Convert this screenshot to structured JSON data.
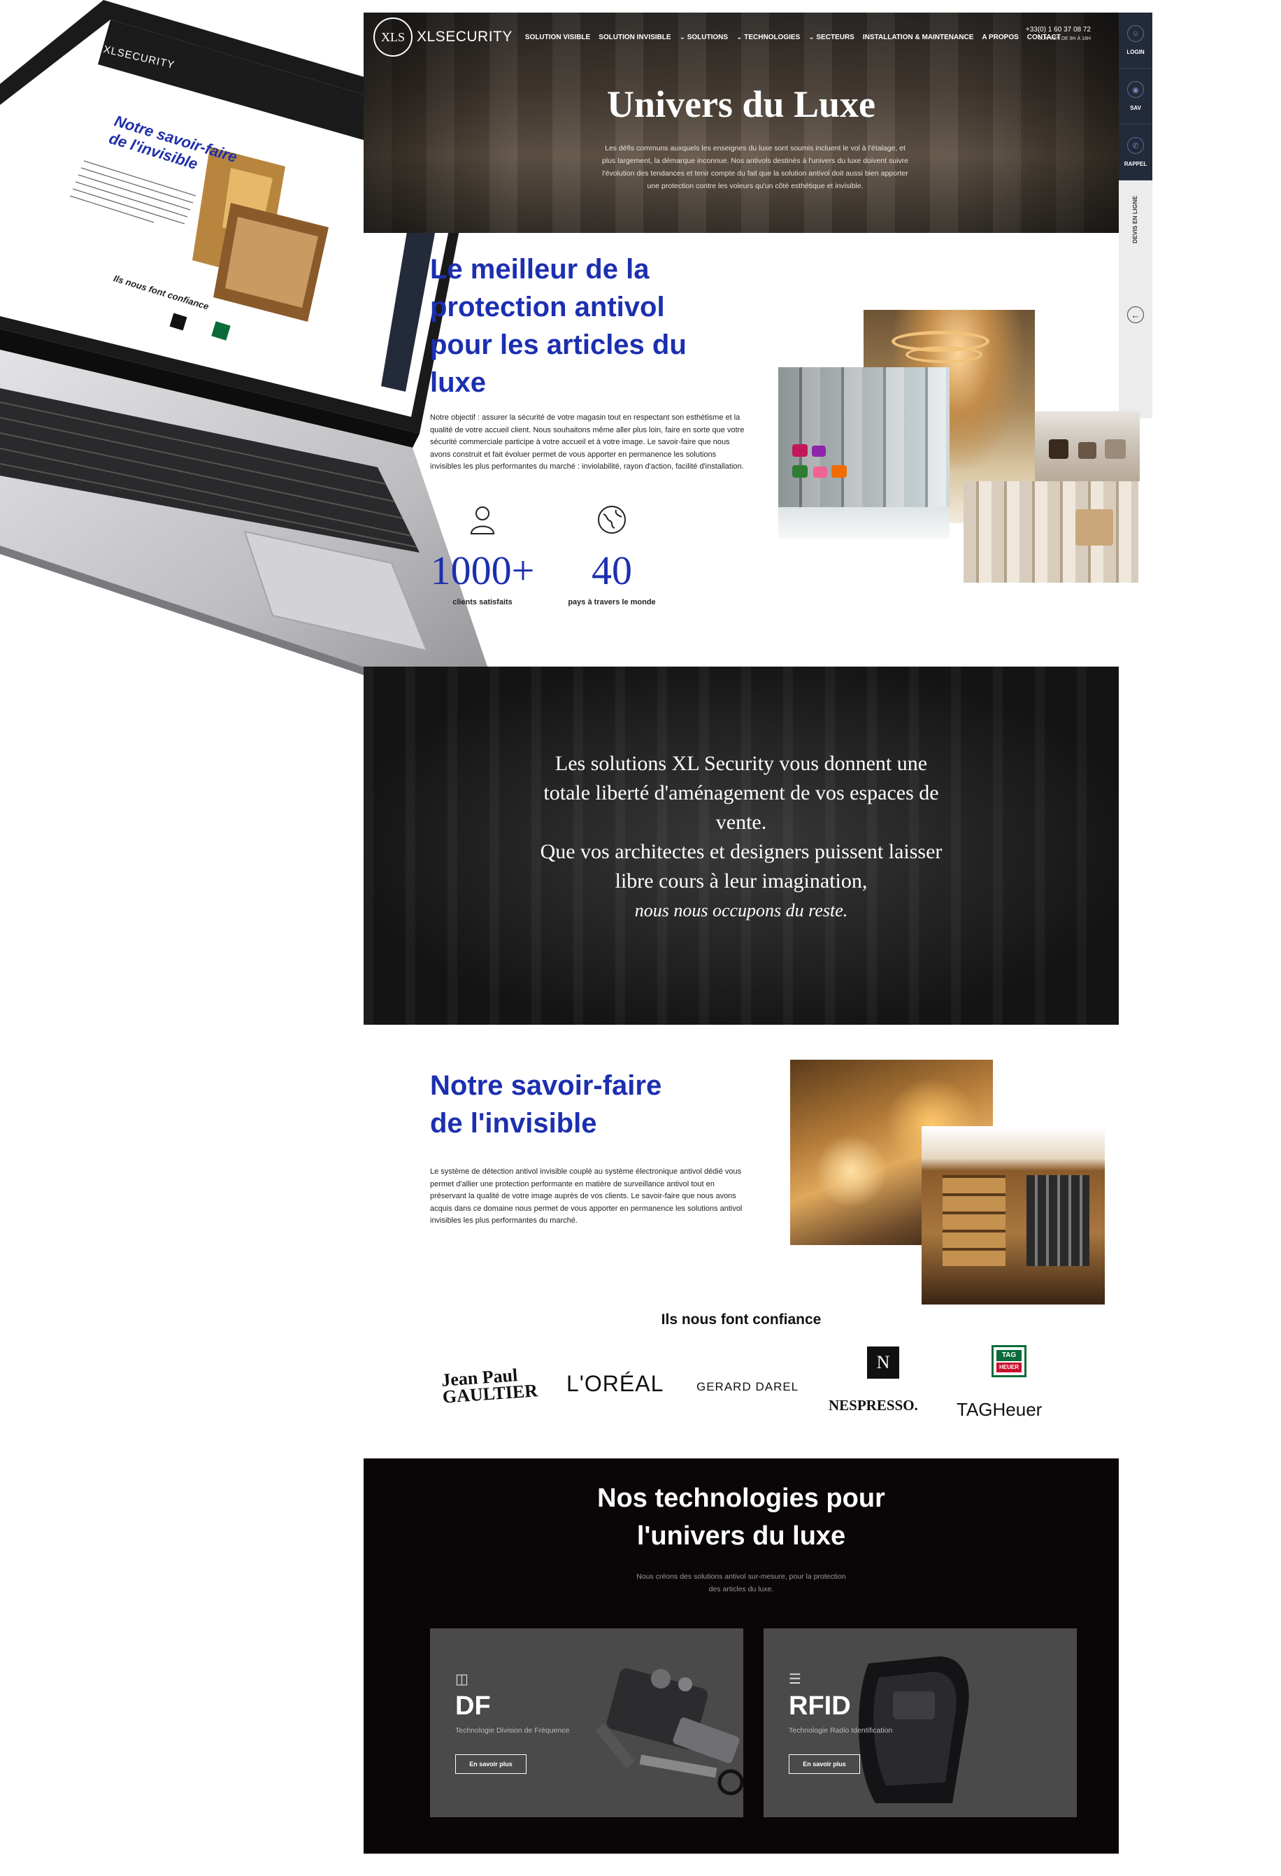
{
  "laptop": {
    "logo": "XLSECURITY",
    "title_line1": "Notre savoir-faire",
    "title_line2": "de l'invisible",
    "trust": "Ils nous font confiance"
  },
  "header": {
    "logo_mark": "XLS",
    "logo_text": "XLSECURITY",
    "nav": [
      "SOLUTION VISIBLE",
      "SOLUTION INVISIBLE",
      "⌄ SOLUTIONS",
      "⌄ TECHNOLOGIES",
      "⌄ SECTEURS",
      "INSTALLATION & MAINTENANCE",
      "A PROPOS",
      "CONTACT"
    ],
    "phone": "+33(0) 1 60 37 08 72",
    "hours": "LUN-VEN DE 9H À 18H"
  },
  "rail": {
    "login": "LOGIN",
    "sav": "SAV",
    "rappel": "RAPPEL",
    "devis": "DEVIS EN LIGNE",
    "arrow": "←"
  },
  "hero": {
    "title": "Univers du Luxe",
    "description": "Les défis communs auxquels les enseignes du luxe sont soumis incluent le vol à l'étalage, et plus largement, la démarque inconnue. Nos antivols destinés à l'univers du luxe doivent suivre l'évolution des tendances et tenir compte du fait que la solution antivol doit aussi bien apporter une protection contre les voleurs qu'un côté esthétique et invisible."
  },
  "best": {
    "title": "Le meilleur de la protection antivol pour les articles du luxe",
    "text": "Notre objectif : assurer la sécurité de votre magasin tout en respectant son esthétisme et la qualité de votre accueil client. Nous souhaitons même aller plus loin, faire en sorte que votre sécurité commerciale participe à votre accueil et à votre image. Le savoir-faire que nous avons construit et fait évoluer permet de vous apporter en permanence les solutions invisibles les plus performantes du marché : inviolabilité, rayon d'action, facilité d'installation.",
    "stats": [
      {
        "icon": "user-icon",
        "value": "1000+",
        "label": "clients satisfaits"
      },
      {
        "icon": "globe-icon",
        "value": "40",
        "label": "pays à travers le monde"
      }
    ]
  },
  "quote": {
    "line1": "Les solutions XL Security vous donnent une totale liberté d'aménagement de vos espaces de vente.",
    "line2": "Que vos architectes et designers puissent laisser libre cours à leur imagination,",
    "line3": "nous nous occupons du reste."
  },
  "savoir": {
    "title_line1": "Notre savoir-faire",
    "title_line2": "de l'invisible",
    "text": "Le système de détection antivol invisible couplé au système électronique antivol dédié vous permet d'allier une protection performante en matière de surveillance antivol tout en préservant la qualité de votre image auprès de vos clients. Le savoir-faire que nous avons acquis dans ce domaine nous permet de vous apporter en permanence les solutions antivol invisibles les plus performantes du marché."
  },
  "trust": {
    "title": "Ils nous font confiance",
    "brands": {
      "jpg_line1": "Jean Paul",
      "jpg_line2": "GAULTIER",
      "loreal": "L'ORÉAL",
      "gd": "GERARD DAREL",
      "nes_mark": "N",
      "nes": "NESPRESSO.",
      "tag_badge1": "TAG",
      "tag_badge2": "HEUER",
      "tag": "TAGHeuer"
    }
  },
  "tech": {
    "title_line1": "Nos technologies pour",
    "title_line2": "l'univers du luxe",
    "subtitle": "Nous créons des solutions antivol sur-mesure, pour la protection des articles du luxe.",
    "cards": [
      {
        "icon": "df-icon",
        "name": "DF",
        "desc": "Technologie Division de Fréquence",
        "button": "En savoir plus"
      },
      {
        "icon": "rfid-icon",
        "name": "RFID",
        "desc": "Technologie Radio Identification",
        "button": "En savoir plus"
      }
    ]
  },
  "colors": {
    "brand_blue": "#1c2fb0",
    "rail_dark": "#232a3a",
    "tech_bg": "#0a0506",
    "card_bg": "#4b4a4a"
  }
}
